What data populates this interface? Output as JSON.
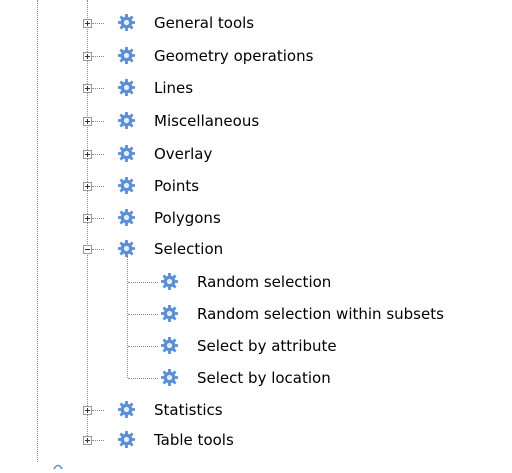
{
  "tree": {
    "groups": [
      {
        "label": "General tools",
        "expanded": false
      },
      {
        "label": "Geometry operations",
        "expanded": false
      },
      {
        "label": "Lines",
        "expanded": false
      },
      {
        "label": "Miscellaneous",
        "expanded": false
      },
      {
        "label": "Overlay",
        "expanded": false
      },
      {
        "label": "Points",
        "expanded": false
      },
      {
        "label": "Polygons",
        "expanded": false
      },
      {
        "label": "Selection",
        "expanded": true
      },
      {
        "label": "Statistics",
        "expanded": false
      },
      {
        "label": "Table tools",
        "expanded": false
      }
    ],
    "selection_children": [
      {
        "label": "Random selection"
      },
      {
        "label": "Random selection within subsets"
      },
      {
        "label": "Select by attribute"
      },
      {
        "label": "Select by location"
      }
    ]
  },
  "colors": {
    "gear_fill": "#5b8fd4",
    "gear_center": "#e4edf9",
    "connector": "#8a8a8a",
    "text": "#000000"
  },
  "icons": {
    "tool": "gear-icon",
    "expand": "plus-box-icon",
    "collapse": "minus-box-icon"
  }
}
